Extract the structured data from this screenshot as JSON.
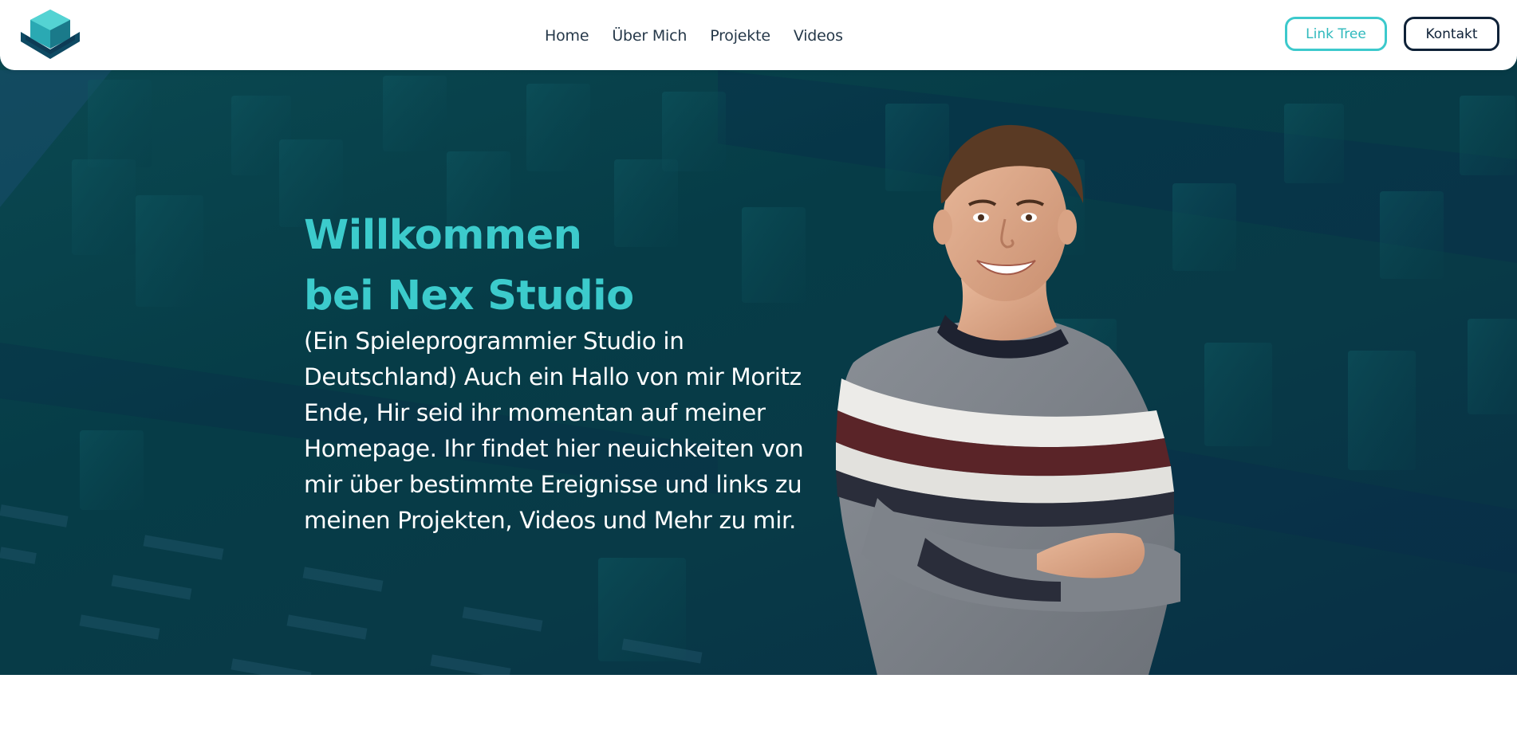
{
  "header": {
    "logo_icon": "nex-studio-hexagon-logo",
    "nav": [
      {
        "label": "Home"
      },
      {
        "label": "Über Mich"
      },
      {
        "label": "Projekte"
      },
      {
        "label": "Videos"
      }
    ],
    "link_tree_label": "Link Tree",
    "kontakt_label": "Kontakt"
  },
  "hero": {
    "title_line1": "Willkommen",
    "title_line2": "bei Nex Studio",
    "description": "(Ein Spieleprogrammier Studio in Deutschland) Auch ein Hallo von mir Moritz Ende, Hir seid ihr momentan auf meiner Homepage. Ihr findet hier neuichkeiten von mir über bestimmte Ereignisse und links zu meinen Projekten, Videos und Mehr zu mir."
  },
  "colors": {
    "accent": "#3ccbcc",
    "dark": "#0f2238",
    "hero_bg": "#063c47"
  }
}
